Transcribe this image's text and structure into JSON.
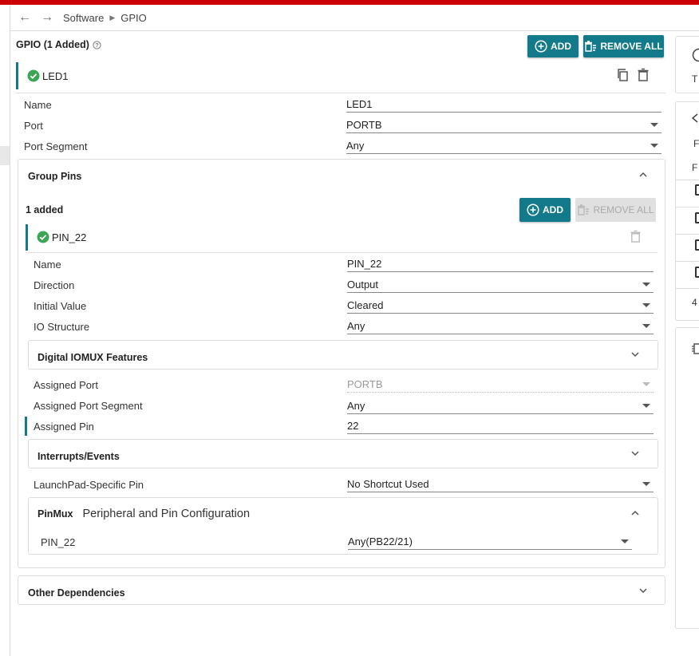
{
  "breadcrumb": {
    "back": "←",
    "forward": "→",
    "items": [
      "Software",
      "GPIO"
    ]
  },
  "gpio": {
    "title": "GPIO (1 Added)",
    "add_label": "ADD",
    "remove_all_label": "REMOVE ALL",
    "instance": "LED1",
    "fields": {
      "name_label": "Name",
      "name_value": "LED1",
      "port_label": "Port",
      "port_value": "PORTB",
      "port_segment_label": "Port Segment",
      "port_segment_value": "Any"
    }
  },
  "group_pins": {
    "title": "Group Pins",
    "count": "1 added",
    "add_label": "ADD",
    "remove_all_label": "REMOVE ALL",
    "pin": "PIN_22",
    "fields": {
      "name_label": "Name",
      "name_value": "PIN_22",
      "direction_label": "Direction",
      "direction_value": "Output",
      "initial_label": "Initial Value",
      "initial_value": "Cleared",
      "io_label": "IO Structure",
      "io_value": "Any"
    }
  },
  "digital_iomux": {
    "title": "Digital IOMUX Features"
  },
  "assigned": {
    "port_label": "Assigned Port",
    "port_value": "PORTB",
    "segment_label": "Assigned Port Segment",
    "segment_value": "Any",
    "pin_label": "Assigned Pin",
    "pin_value": "22"
  },
  "interrupts": {
    "title": "Interrupts/Events"
  },
  "launchpad": {
    "label": "LaunchPad-Specific Pin",
    "value": "No Shortcut Used"
  },
  "pinmux": {
    "title": "PinMux",
    "subtitle": "Peripheral and Pin Configuration",
    "pin_label": "PIN_22",
    "pin_value": "Any(PB22/21)"
  },
  "other": {
    "title": "Other Dependencies"
  },
  "right": {
    "t1": "T",
    "t2": "F",
    "t3": "F",
    "t4": "4"
  },
  "colors": {
    "accent": "#127a8a",
    "topbar": "#cc0000",
    "check": "#3aa655"
  }
}
